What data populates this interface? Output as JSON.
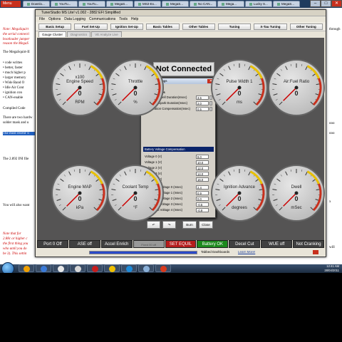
{
  "browser": {
    "menu_label": "Menu",
    "tabs": [
      "Downlo...",
      "YouTu...",
      "YouTu...",
      "MegaS...",
      "MS2-Ex...",
      "MegaS...",
      "No CAN...",
      "Mega...",
      "Lucky S...",
      "MegaS..."
    ]
  },
  "webpage": {
    "lines": [
      {
        "text": "Note: MegaSquirt",
        "style": "red"
      },
      {
        "text": "the serial connecti",
        "style": "red"
      },
      {
        "text": "bootloader jumper",
        "style": "red"
      },
      {
        "text": "reason the MegaS",
        "style": "red"
      },
      {
        "text": "The MegaSquirt-II",
        "style": "normal"
      },
      {
        "text": "• code writtes",
        "style": "normal"
      },
      {
        "text": "• better, faster",
        "style": "normal"
      },
      {
        "text": "• much higher p",
        "style": "normal"
      },
      {
        "text": "• larger memory",
        "style": "normal"
      },
      {
        "text": "• Wide Band O",
        "style": "normal"
      },
      {
        "text": "• Idle Air Cont",
        "style": "normal"
      },
      {
        "text": "• ignition con",
        "style": "normal"
      },
      {
        "text": "• CAN-enable",
        "style": "normal"
      },
      {
        "text": "Compiled Code",
        "style": "normal"
      },
      {
        "text": "There are two hardw",
        "style": "normal"
      },
      {
        "text": "solder mask and u",
        "style": "normal"
      },
      {
        "text": "The most recent 'o",
        "style": "blue"
      },
      {
        "text": "The 2.892 INI file",
        "style": "normal"
      },
      {
        "text": "You will also want",
        "style": "normal"
      },
      {
        "text": "Note that for",
        "style": "red"
      },
      {
        "text": "2.88c or higher c",
        "style": "red"
      },
      {
        "text": "the first thing you",
        "style": "red"
      },
      {
        "text": "who until you do",
        "style": "red"
      },
      {
        "text": "be 3). This settin",
        "style": "red"
      }
    ],
    "right_fragments": [
      "through",
      "ooo",
      "ooo",
      "x",
      "will"
    ]
  },
  "app": {
    "title": "TunerStudio MS Lite! v1.002 - 2882 EFI Simplified",
    "menu": [
      "File",
      "Options",
      "Data Logging",
      "Communications",
      "Tools",
      "Help"
    ],
    "toolbar": [
      "Basic Setup",
      "Fuel Set-Up",
      "Ignition Set-Up",
      "Basic Tables",
      "Other Tables",
      "Tuning",
      "X-Tau Tuning",
      "Other Tuning"
    ],
    "tabs": [
      "Gauge Cluster",
      "Diagnostics",
      "VE Analyze Live"
    ],
    "active_tab": "Gauge Cluster",
    "not_connected": "Not Connected"
  },
  "gauges": [
    {
      "id": "rpm",
      "title": "Engine Speed",
      "sub": "x100",
      "value": "0",
      "unit": "RPM"
    },
    {
      "id": "tps",
      "title": "Throttle",
      "sub": "",
      "value": "0",
      "unit": "%"
    },
    {
      "id": "pw",
      "title": "Pulse Width 1",
      "sub": "",
      "value": "0",
      "unit": "ms"
    },
    {
      "id": "afr",
      "title": "Air:Fuel Ratio",
      "sub": "",
      "value": "0",
      "unit": ""
    },
    {
      "id": "map",
      "title": "Engine MAP",
      "sub": "",
      "value": "0",
      "unit": "kPa"
    },
    {
      "id": "clt",
      "title": "Coolant Temp",
      "sub": "",
      "value": "0",
      "unit": "°F"
    },
    {
      "id": "adv",
      "title": "Ignition Advance",
      "sub": "",
      "value": "0",
      "unit": "degrees"
    },
    {
      "id": "dwell",
      "title": "Dwell",
      "sub": "",
      "value": "0",
      "unit": "mSec"
    }
  ],
  "dialog": {
    "title": "Dwell Settings",
    "help": "Help",
    "group_label": "Dwell Settings",
    "rows": [
      {
        "label": "Maximum Dwell Duration(msec)",
        "value": "3.5"
      },
      {
        "label": "Maximum Spark Duration(msec)",
        "value": "2.0"
      },
      {
        "label": "Acceleration Compensation(msec)",
        "value": "0.5"
      }
    ],
    "comp_header": "Battery Voltage Compensation",
    "voltage_rows": [
      {
        "label": "Voltage 0 (V)",
        "value": "8.0"
      },
      {
        "label": "Voltage 1 (V)",
        "value": "10.0"
      },
      {
        "label": "Voltage 2 (V)",
        "value": "12.0"
      },
      {
        "label": "Voltage 3 (V)",
        "value": "14.0"
      },
      {
        "label": "Voltage 4 (V)",
        "value": "16.0"
      }
    ],
    "duration_rows": [
      {
        "label": "Duration at Voltage 0 (msec)",
        "value": "2.4"
      },
      {
        "label": "Duration at Voltage 1 (msec)",
        "value": "0.9"
      },
      {
        "label": "Duration at Voltage 2 (msec)",
        "value": "0.0"
      },
      {
        "label": "Duration at Voltage 3 (msec)",
        "value": "-0.5"
      },
      {
        "label": "Duration at Voltage 4 (msec)",
        "value": "-0.9"
      }
    ],
    "buttons": {
      "undo": "↶",
      "redo": "↷",
      "burn": "Burn",
      "close": "Close"
    }
  },
  "status_indicators": [
    {
      "label": "Port 0 Off",
      "state": "off"
    },
    {
      "label": "ASE off",
      "state": "off"
    },
    {
      "label": "Accel Enrich",
      "state": "off"
    },
    {
      "label": "Fixed 00 off",
      "state": "dim"
    },
    {
      "label": "SET EQUIL",
      "state": "err"
    },
    {
      "label": "Battery OK",
      "state": "ok"
    },
    {
      "label": "Decel Cut",
      "state": "off"
    },
    {
      "label": "WUE off",
      "state": "off"
    },
    {
      "label": "Not Cranking",
      "state": "off"
    }
  ],
  "bottom": {
    "progress": 1.0,
    "dashboard_label": "Tabbed Dashboards",
    "learn_more": "Learn More!"
  },
  "taskbar": {
    "time": "12:41 AM",
    "date": "28/04/2011"
  },
  "colors": {
    "dashboard_bg": "#555454",
    "accent_red": "#c8301d",
    "progress": "#2a49c9",
    "ok_green": "#1d8a1d"
  }
}
